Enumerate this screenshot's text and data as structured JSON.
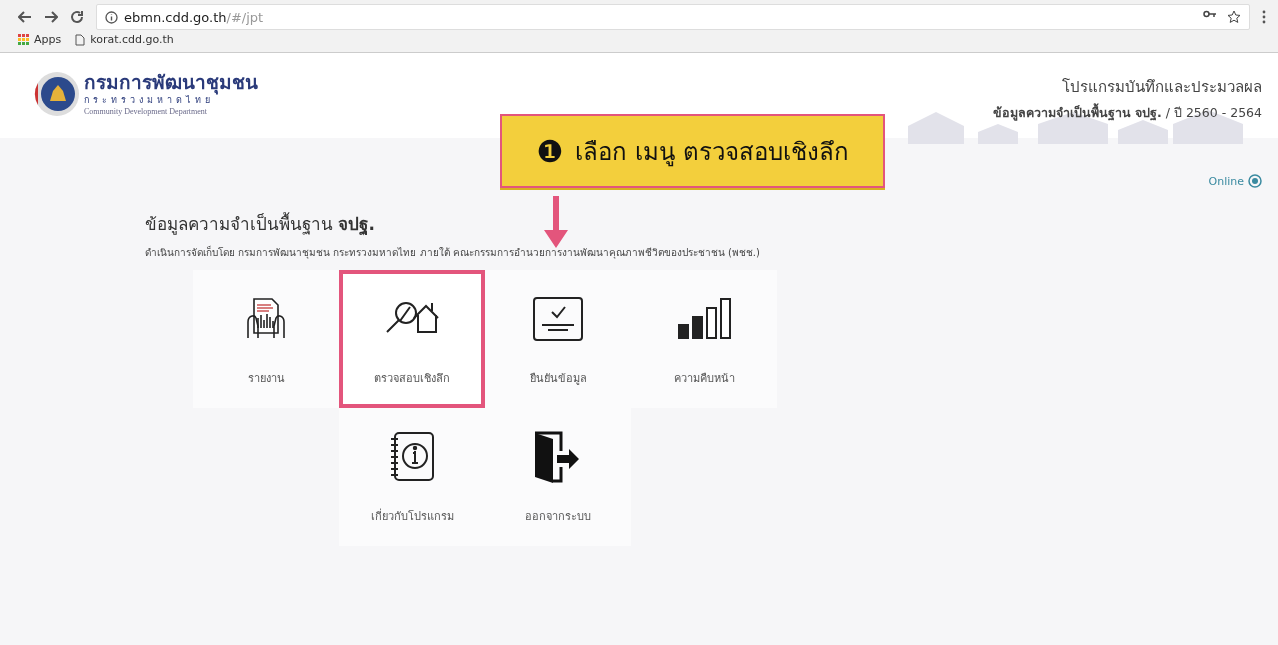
{
  "browser": {
    "url": "ebmn.cdd.go.th",
    "url_path": "/#/jpt",
    "bookmarks": [
      {
        "label": "Apps",
        "kind": "apps"
      },
      {
        "label": "korat.cdd.go.th",
        "kind": "page"
      }
    ]
  },
  "header": {
    "org_name": "กรมการพัฒนาชุมชน",
    "ministry": "กระทรวงมหาดไทย",
    "org_name_en": "Community Development Department",
    "program_title": "โปรแกรมบันทึกและประมวลผล",
    "program_subtitle": "**ข้อมูลความจำเป็นพื้นฐาน จปฐ.** / ปี 2560 - 2564",
    "status": "Online"
  },
  "callout": {
    "badge": "❶",
    "text": "เลือก เมนู ตรวจสอบเชิงลึก"
  },
  "main": {
    "title": "ข้อมูลความจำเป็นพื้นฐาน **จปฐ.**",
    "description": "ดำเนินการจัดเก็บโดย กรมการพัฒนาชุมชน กระทรวงมหาดไทย ภายใต้ คณะกรรมการอำนวยการงานพัฒนาคุณภาพชีวิตของประชาชน (พชช.)"
  },
  "menu": [
    {
      "label": "รายงาน",
      "kind": "report",
      "selected": false
    },
    {
      "label": "ตรวจสอบเชิงลึก",
      "kind": "inspect",
      "selected": true
    },
    {
      "label": "ยืนยันข้อมูล",
      "kind": "confirm",
      "selected": false
    },
    {
      "label": "ความคืบหน้า",
      "kind": "progress",
      "selected": false
    },
    {
      "label": "เกี่ยวกับโปรแกรม",
      "kind": "about",
      "selected": false
    },
    {
      "label": "ออกจากระบบ",
      "kind": "logout",
      "selected": false
    }
  ]
}
